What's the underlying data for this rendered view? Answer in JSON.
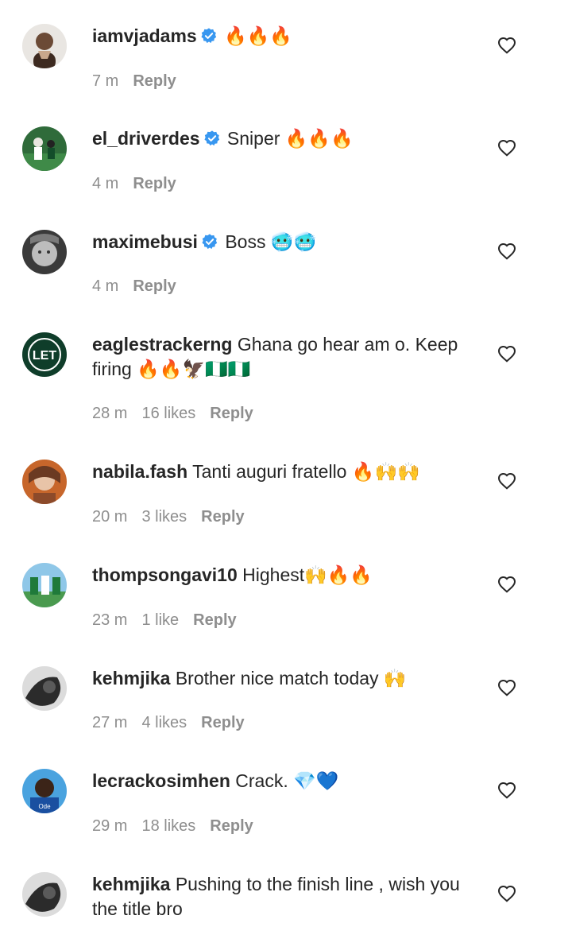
{
  "colors": {
    "verified_badge": "#3897f0",
    "username": "#262626",
    "meta_text": "#8e8e8e"
  },
  "comments": [
    {
      "username": "iamvjadams",
      "verified": true,
      "text": "🔥🔥🔥",
      "time": "7 m",
      "likes": "",
      "reply": "Reply"
    },
    {
      "username": "el_driverdes",
      "verified": true,
      "text": "Sniper 🔥🔥🔥",
      "time": "4 m",
      "likes": "",
      "reply": "Reply"
    },
    {
      "username": "maximebusi",
      "verified": true,
      "text": "Boss 🥶🥶",
      "time": "4 m",
      "likes": "",
      "reply": "Reply"
    },
    {
      "username": "eaglestrackerng",
      "verified": false,
      "text": "Ghana go hear am o. Keep firing 🔥🔥🦅🇳🇬🇳🇬",
      "time": "28 m",
      "likes": "16 likes",
      "reply": "Reply"
    },
    {
      "username": "nabila.fash",
      "verified": false,
      "text": "Tanti auguri fratello 🔥🙌🙌",
      "time": "20 m",
      "likes": "3 likes",
      "reply": "Reply"
    },
    {
      "username": "thompsongavi10",
      "verified": false,
      "text": "Highest🙌🔥🔥",
      "time": "23 m",
      "likes": "1 like",
      "reply": "Reply"
    },
    {
      "username": "kehmjika",
      "verified": false,
      "text": "Brother nice match today 🙌",
      "time": "27 m",
      "likes": "4 likes",
      "reply": "Reply"
    },
    {
      "username": "lecrackosimhen",
      "verified": false,
      "text": "Crack. 💎💙",
      "time": "29 m",
      "likes": "18 likes",
      "reply": "Reply"
    },
    {
      "username": "kehmjika",
      "verified": false,
      "text": "Pushing to the finish line , wish you the title bro",
      "time": "",
      "likes": "",
      "reply": ""
    }
  ]
}
